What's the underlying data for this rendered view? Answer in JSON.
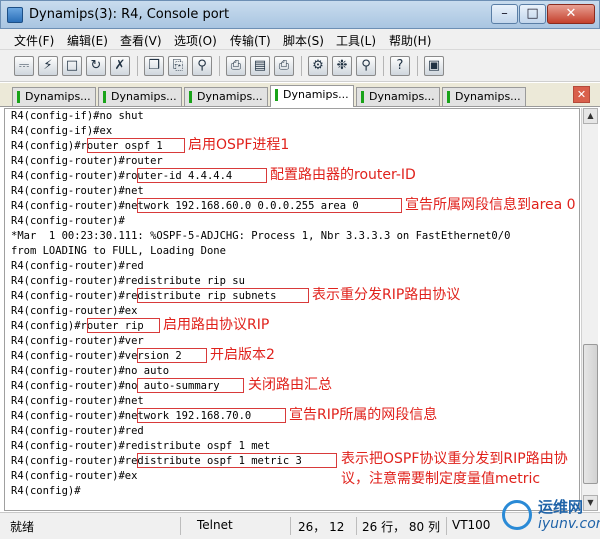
{
  "window": {
    "title": "Dynamips(3): R4, Console port"
  },
  "menu": [
    "文件(F)",
    "编辑(E)",
    "查看(V)",
    "选项(O)",
    "传输(T)",
    "脚本(S)",
    "工具(L)",
    "帮助(H)"
  ],
  "toolbar_icons": [
    "connect-icon",
    "quick-connect-icon",
    "connect-tab-icon",
    "reconnect-icon",
    "disconnect-icon",
    "copy-icon",
    "paste-icon",
    "find-icon",
    "print-icon",
    "print-setup-icon",
    "printer-icon",
    "session-options-icon",
    "global-options-icon",
    "keymap-icon",
    "help-icon",
    "extra-icon"
  ],
  "tabs": [
    {
      "label": "Dynamips...",
      "active": false
    },
    {
      "label": "Dynamips...",
      "active": false
    },
    {
      "label": "Dynamips...",
      "active": false
    },
    {
      "label": "Dynamips...",
      "active": true
    },
    {
      "label": "Dynamips...",
      "active": false
    },
    {
      "label": "Dynamips...",
      "active": false
    }
  ],
  "terminal_lines": [
    "R4(config-if)#no shut",
    "R4(config-if)#ex",
    "R4(config)#router ospf 1",
    "R4(config-router)#router",
    "R4(config-router)#router-id 4.4.4.4",
    "R4(config-router)#net",
    "R4(config-router)#network 192.168.60.0 0.0.0.255 area 0",
    "R4(config-router)#",
    "*Mar  1 00:23:30.111: %OSPF-5-ADJCHG: Process 1, Nbr 3.3.3.3 on FastEthernet0/0",
    "from LOADING to FULL, Loading Done",
    "R4(config-router)#red",
    "R4(config-router)#redistribute rip su",
    "R4(config-router)#redistribute rip subnets",
    "R4(config-router)#ex",
    "R4(config)#router rip",
    "R4(config-router)#ver",
    "R4(config-router)#version 2",
    "R4(config-router)#no auto",
    "R4(config-router)#no auto-summary",
    "R4(config-router)#net",
    "R4(config-router)#network 192.168.70.0",
    "R4(config-router)#red",
    "R4(config-router)#redistribute ospf 1 met",
    "R4(config-router)#redistribute ospf 1 metric 3",
    "R4(config-router)#ex",
    "R4(config)#"
  ],
  "annotations": [
    "启用OSPF进程1",
    "配置路由器的router-ID",
    "宣告所属网段信息到area 0",
    "表示重分发RIP路由协议",
    "启用路由协议RIP",
    "开启版本2",
    "关闭路由汇总",
    "宣告RIP所属的网段信息",
    "表示把OSPF协议重分发到RIP路由协",
    "议，注意需要制定度量值metric"
  ],
  "status": {
    "state": "就绪",
    "protocol": "Telnet",
    "cursor": "26，  12",
    "size": "26 行， 80 列",
    "terminal": "VT100"
  },
  "watermark": {
    "line1": "运维网",
    "line2": "iyunv.com"
  },
  "colors": {
    "annotation": "#e0221c",
    "tab_marker": "#19a319"
  }
}
